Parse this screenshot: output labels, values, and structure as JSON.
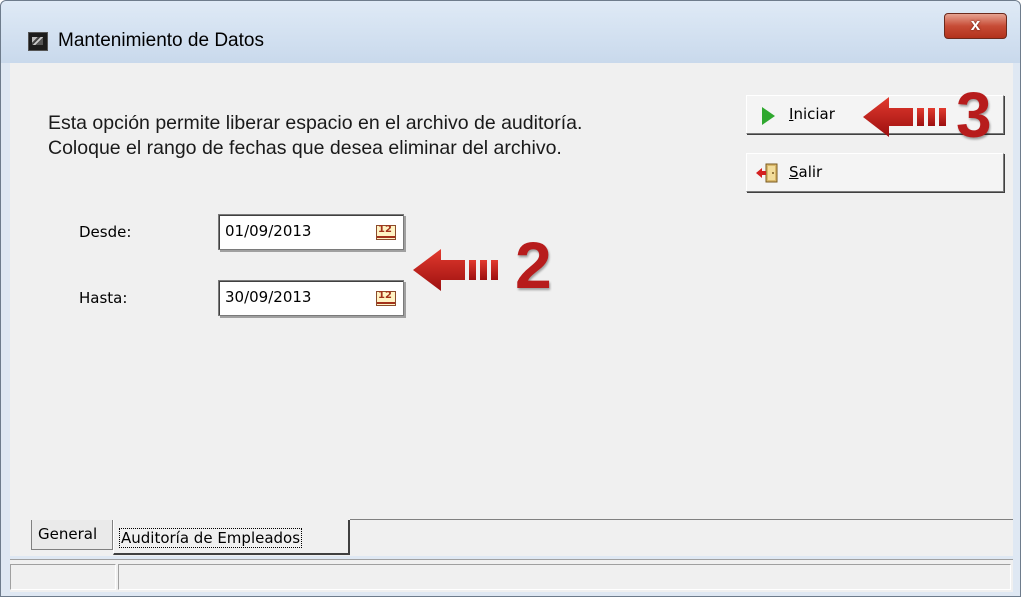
{
  "window": {
    "title": "Mantenimiento de Datos",
    "close_label": "x"
  },
  "description": {
    "line1": "Esta opción permite liberar espacio en el archivo de auditoría.",
    "line2": "Coloque el rango de fechas que desea eliminar del archivo."
  },
  "form": {
    "desde_label": "Desde:",
    "desde_value": "01/09/2013",
    "hasta_label": "Hasta:",
    "hasta_value": "30/09/2013"
  },
  "buttons": {
    "iniciar_prefix": "I",
    "iniciar_rest": "niciar",
    "salir_prefix": "S",
    "salir_rest": "alir"
  },
  "annotations": {
    "step_dates": "2",
    "step_start": "3",
    "arrow_color": "#b71c1c"
  },
  "tabs": [
    {
      "label": "General"
    },
    {
      "label": "Auditoría de Empleados",
      "selected": true
    }
  ],
  "icons": {
    "app": "app-icon",
    "close": "close-icon",
    "calendar": "calendar-icon",
    "play": "play-icon",
    "exit": "exit-door-icon"
  }
}
